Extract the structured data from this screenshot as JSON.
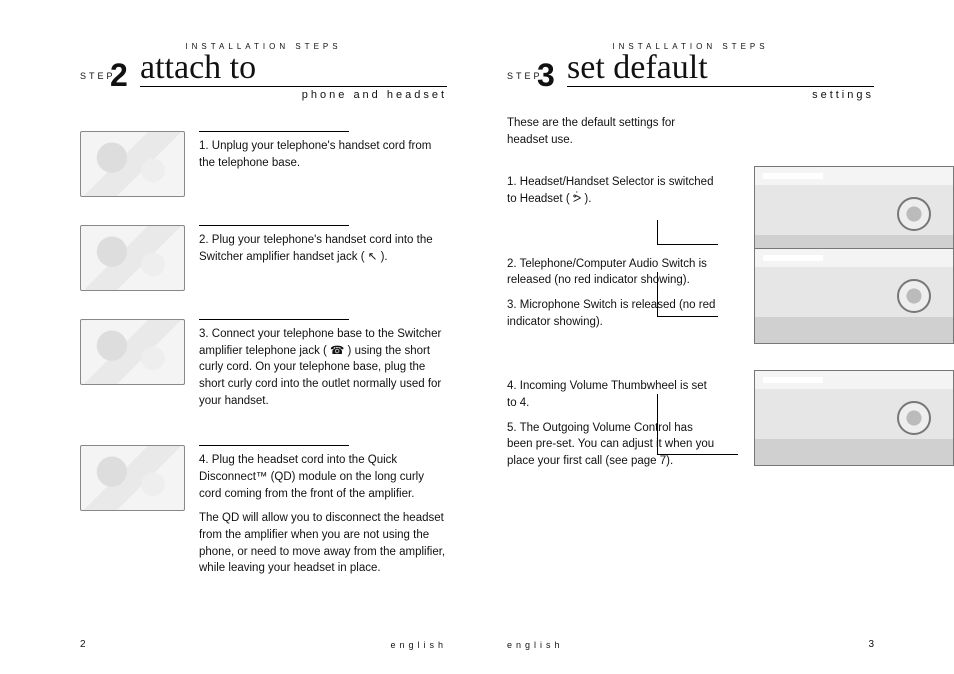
{
  "left": {
    "eyebrow": "INSTALLATION STEPS",
    "step_label": "STEP",
    "step_num": "2",
    "title": "attach to",
    "subtitle": "phone and headset",
    "items": [
      {
        "text": "1. Unplug your telephone's handset cord from the telephone base."
      },
      {
        "text": "2. Plug your telephone's handset cord into the Switcher amplifier handset jack ( ↖ )."
      },
      {
        "text": "3. Connect your telephone base to the Switcher amplifier telephone jack ( ☎ ) using the short curly cord. On your telephone base, plug the short curly cord into the outlet normally used for your handset."
      },
      {
        "text": "4. Plug the headset cord into the Quick Disconnect™ (QD) module on the long curly cord coming from the front of the amplifier.",
        "text2": "The QD will allow you to disconnect the headset from the amplifier when you are not using the phone, or need to move away from the amplifier, while leaving your headset in place."
      }
    ],
    "page_number": "2",
    "footer": "english"
  },
  "right": {
    "eyebrow": "INSTALLATION STEPS",
    "step_label": "STEP",
    "step_num": "3",
    "title": "set default",
    "subtitle": "settings",
    "intro": "These are the default settings for headset use.",
    "blocks": [
      {
        "lines": [
          "1. Headset/Handset Selector is switched to Headset ( ᕘ )."
        ]
      },
      {
        "lines": [
          "2. Telephone/Computer Audio Switch is released (no red indicator showing).",
          "3. Microphone Switch is released (no red indicator showing)."
        ]
      },
      {
        "lines": [
          "4. Incoming Volume Thumbwheel is set to 4.",
          "5. The Outgoing Volume Control has been pre-set. You can adjust it when you place your first call (see page 7)."
        ]
      }
    ],
    "page_number": "3",
    "footer": "english"
  }
}
